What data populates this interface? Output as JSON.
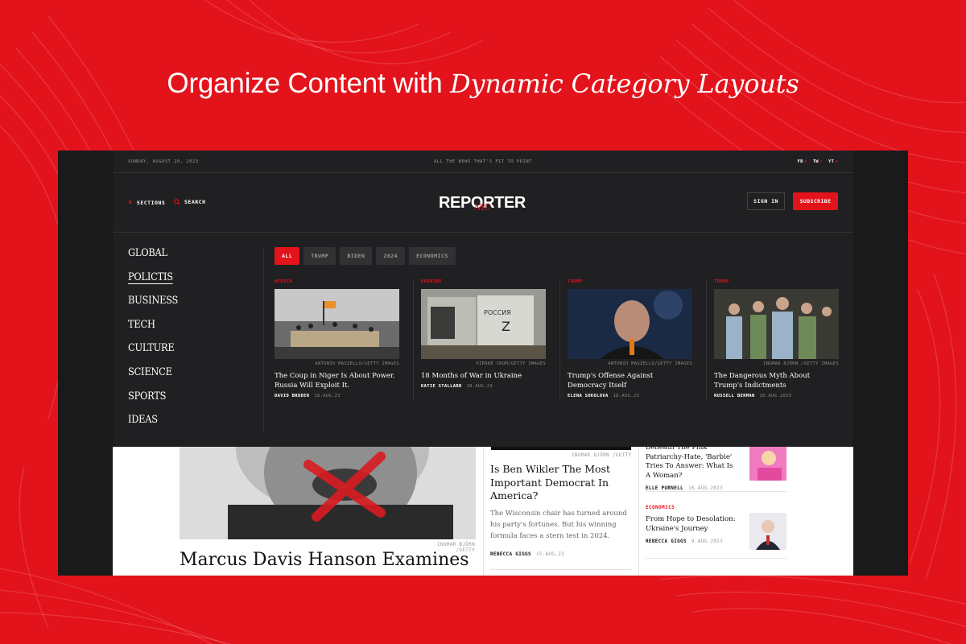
{
  "colors": {
    "brand_red": "#e3131c",
    "dark": "#1a1a1b",
    "panel": "#202022"
  },
  "banner": {
    "headline_plain": "Organize Content with ",
    "headline_italic": "Dynamic Category Layouts"
  },
  "topbar": {
    "date": "SUNDAY, AUGUST 20, 2023",
    "tagline": "ALL THE NEWS THAT'S FIT TO PRINT",
    "social": [
      {
        "label": "FB",
        "icon": "arrow-up-right-icon"
      },
      {
        "label": "TW",
        "icon": "arrow-up-right-icon"
      },
      {
        "label": "YT",
        "icon": "arrow-up-right-icon"
      }
    ]
  },
  "header": {
    "sections_label": "SECTIONS",
    "search_label": "SEARCH",
    "logo_text": "REPORTER",
    "logo_sub": "NYC",
    "signin_label": "SIGN IN",
    "subscribe_label": "SUBSCRIBE"
  },
  "menu": {
    "items": [
      "GLOBAL",
      "POLICTIS",
      "BUSINESS",
      "TECH",
      "CULTURE",
      "SCIENCE",
      "SPORTS",
      "IDEAS"
    ],
    "active": "POLICTIS"
  },
  "filters": {
    "tabs": [
      "ALL",
      "TRUMP",
      "BIDEN",
      "2024",
      "ECONOMICS"
    ],
    "active": "ALL"
  },
  "cards": [
    {
      "category": "AFRICA",
      "credit": "ANTONIO MASIELLO/GETTY IMAGES",
      "title": "The Coup in Niger Is About Power. Russia Will Exploit It.",
      "author": "DAVID BRODER",
      "date": "18.AUG.23"
    },
    {
      "category": "UKRAINE",
      "credit": "PIERRE CROM/GETTY IMAGES",
      "title": "18 Months of War in Ukraine",
      "author": "KATIE STALLARD",
      "date": "18.AUG.23"
    },
    {
      "category": "TRUMP",
      "credit": "ANTONIO MASIELLO/GETTY IMAGES",
      "title": "Trump's Offense Against Democracy Itself",
      "author": "ELENA SOKOLOVA",
      "date": "18.AUG.23"
    },
    {
      "category": "TRUMP",
      "credit": "INGMAR BJÖRN /GETTY IMAGES",
      "title": "The Dangerous Myth About Trump's Indictments",
      "author": "RUSSELL BERMAN",
      "date": "20.AUG.2023"
    }
  ],
  "page": {
    "hero_credit": "INGMAR BJÖRN /GETTY",
    "hero_title": "Marcus Davis Hanson Examines",
    "mid_credit": "INGMAR BJÖRN /GETTY",
    "mid_title": "Is Ben Wikler The Most Important Democrat In America?",
    "mid_body": "The Wisconsin chair has turned around his party's fortunes. But his winning formula faces a stern test in 2024.",
    "mid_author": "REBECCA GIGGS",
    "mid_date": "15.AUG.23",
    "right_items": [
      {
        "category": "",
        "title": "Beneath The Pink Patriarchy-Hate, 'Barbie' Tries To Answer: What Is A Woman?",
        "author": "ELLE PURNELL",
        "date": "16.AUG.2023"
      },
      {
        "category": "ECONOMICS",
        "title": "From Hope to Desolation: Ukraine's Journey",
        "author": "REBECCA GIGGS",
        "date": "9.AUG.2023"
      }
    ]
  }
}
